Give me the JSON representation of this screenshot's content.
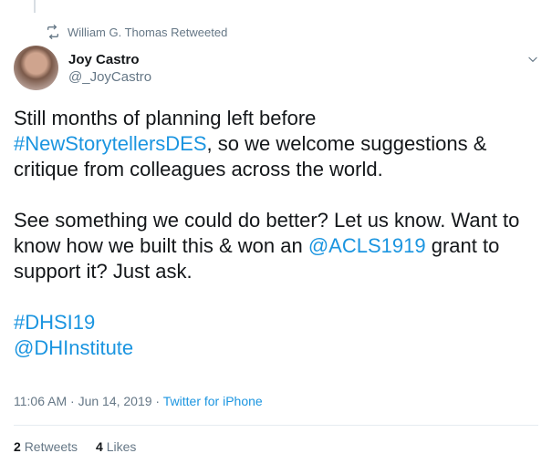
{
  "retweet_header": {
    "label": "William G. Thomas Retweeted",
    "icon": "retweet-icon"
  },
  "author": {
    "display_name": "Joy Castro",
    "handle": "@_JoyCastro"
  },
  "tweet": {
    "line1": "Still months of planning left before",
    "hashtag_des": "#NewStorytellersDES",
    "line2_rest": ", so we welcome suggestions &",
    "line3": "critique from colleagues across the world.",
    "para2_a": "See something we could do better? Let us know. Want to know how we built this & won an ",
    "mention_acls": "@ACLS1919",
    "para2_b": " grant to support it? Just ask.",
    "hashtag_dhsi": "#DHSI19",
    "mention_dhi": "@DHInstitute"
  },
  "meta": {
    "time": "11:06 AM",
    "sep1": " · ",
    "date": "Jun 14, 2019",
    "sep2": " · ",
    "source": "Twitter for iPhone"
  },
  "stats": {
    "retweets_count": "2",
    "retweets_label": "Retweets",
    "likes_count": "4",
    "likes_label": "Likes"
  },
  "colors": {
    "link": "#1b95e0",
    "muted": "#657786",
    "text": "#14171a"
  }
}
